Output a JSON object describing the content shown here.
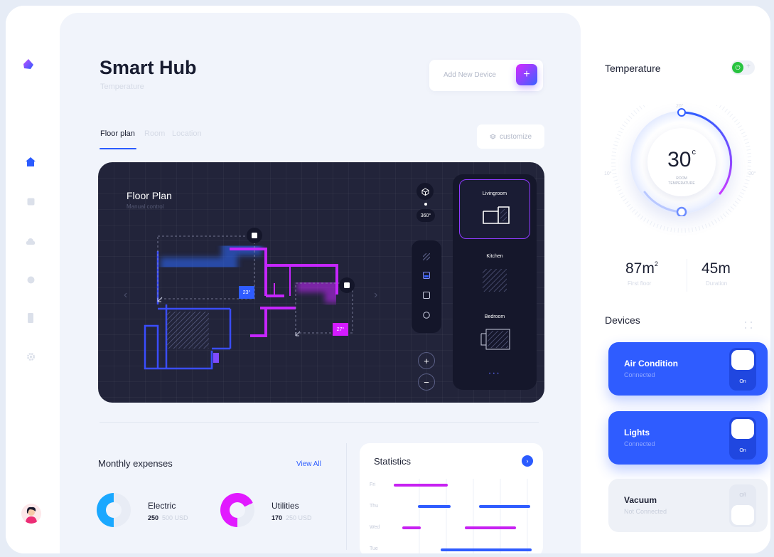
{
  "app": {
    "title": "Smart Hub",
    "subtitle": "Temperature"
  },
  "header": {
    "add_device_label": "Add New Device",
    "add_icon": "+",
    "customize_label": "customize"
  },
  "tabs": [
    {
      "label": "Floor plan",
      "active": true
    },
    {
      "label": "Room",
      "active": false
    },
    {
      "label": "Location",
      "active": false
    }
  ],
  "floorplan": {
    "title": "Floor Plan",
    "subtitle": "Manual control",
    "zone1_temp": "23°",
    "zone2_temp": "27°",
    "view_label": "360°",
    "zoom_in": "+",
    "zoom_out": "−",
    "nav_left": "‹",
    "nav_right": "›",
    "rooms": [
      {
        "name": "Livingroom",
        "active": true
      },
      {
        "name": "Kitchen",
        "active": false
      },
      {
        "name": "Bedroom",
        "active": false
      }
    ],
    "pager": "• • •"
  },
  "expenses": {
    "title": "Monthly expenses",
    "view_all": "View All",
    "items": [
      {
        "label": "Electric",
        "value": "250",
        "total": "500 USD",
        "fraction": 0.5,
        "color": "#1aa8ff"
      },
      {
        "label": "Utilities",
        "value": "170",
        "total": "250 USD",
        "fraction": 0.68,
        "color": "#e11aff"
      }
    ]
  },
  "statistics": {
    "title": "Statistics",
    "arrow": "›",
    "days": [
      "Fri",
      "Thu",
      "Wed",
      "Tue"
    ],
    "colors": {
      "purple": "#c721f2",
      "blue": "#2f5cff"
    }
  },
  "temperature": {
    "title": "Temperature",
    "value": "30",
    "unit": "c",
    "label_line1": "ROOM",
    "label_line2": "TEMPERATURE",
    "tick_top": "20°",
    "tick_left": "10°",
    "tick_right": "30°",
    "power_icon": "⏻",
    "plus_icon": "+"
  },
  "metrics": [
    {
      "value": "87m",
      "sup": "2",
      "label": "First floor"
    },
    {
      "value": "45m",
      "sup": "",
      "label": "Duration"
    }
  ],
  "devices": {
    "title": "Devices",
    "items": [
      {
        "name": "Air Condition",
        "status": "Connected",
        "state": "On"
      },
      {
        "name": "Lights",
        "status": "Connected",
        "state": "On"
      },
      {
        "name": "Vacuum",
        "status": "Not Connected",
        "state": "Off"
      }
    ]
  }
}
